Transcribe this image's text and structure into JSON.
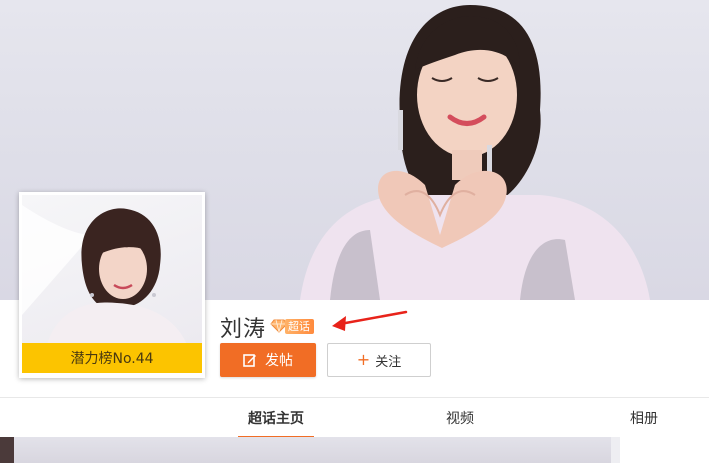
{
  "profile": {
    "name": "刘涛",
    "badge_label": "超话",
    "rank_label": "潜力榜No.44"
  },
  "actions": {
    "post_label": "发帖",
    "follow_label": "关注"
  },
  "tabs": [
    {
      "label": "超话主页",
      "active": true
    },
    {
      "label": "视频",
      "active": false
    },
    {
      "label": "相册",
      "active": false
    }
  ],
  "colors": {
    "accent": "#f16d25",
    "rank_bar": "#fcc400",
    "annotation_arrow": "#e8231a"
  }
}
